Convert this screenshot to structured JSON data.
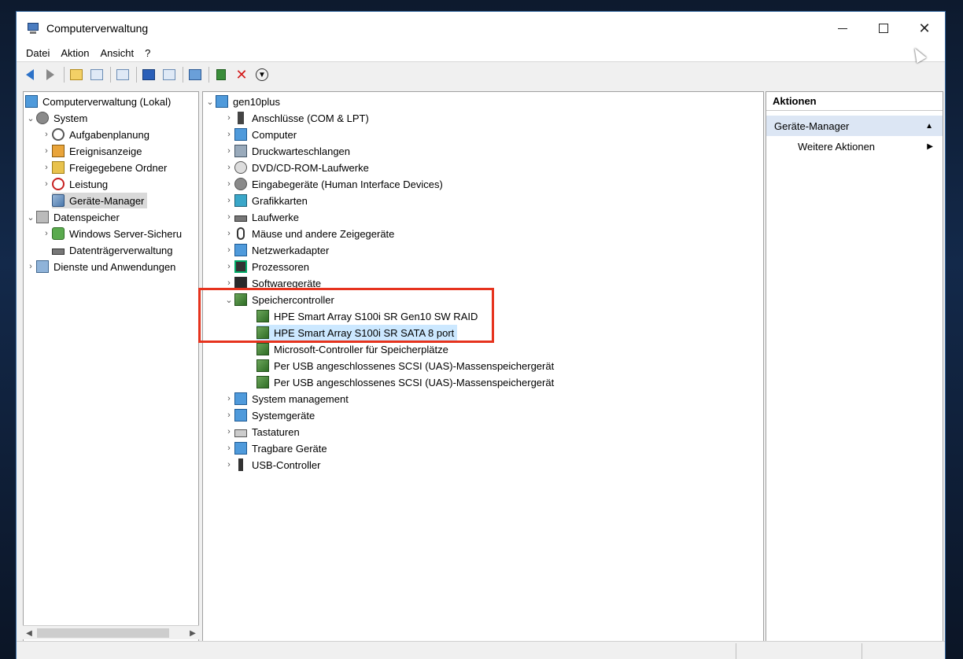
{
  "window": {
    "title": "Computerverwaltung",
    "close_glyph": "✕"
  },
  "menu": [
    "Datei",
    "Aktion",
    "Ansicht",
    "?"
  ],
  "left_tree": {
    "root": "Computerverwaltung (Lokal)",
    "system": "System",
    "system_children": [
      "Aufgabenplanung",
      "Ereignisanzeige",
      "Freigegebene Ordner",
      "Leistung",
      "Geräte-Manager"
    ],
    "storage": "Datenspeicher",
    "storage_children": [
      "Windows Server-Sicheru",
      "Datenträgerverwaltung"
    ],
    "services": "Dienste und Anwendungen"
  },
  "device_tree": {
    "root": "gen10plus",
    "categories_before": [
      "Anschlüsse (COM & LPT)",
      "Computer",
      "Druckwarteschlangen",
      "DVD/CD-ROM-Laufwerke",
      "Eingabegeräte (Human Interface Devices)",
      "Grafikkarten",
      "Laufwerke",
      "Mäuse und andere Zeigegeräte",
      "Netzwerkadapter",
      "Prozessoren",
      "Softwaregeräte"
    ],
    "expanded": "Speichercontroller",
    "expanded_children": [
      "HPE Smart Array S100i SR Gen10 SW RAID",
      "HPE Smart Array S100i SR SATA 8 port",
      "Microsoft-Controller für Speicherplätze",
      "Per USB angeschlossenes SCSI (UAS)-Massenspeichergerät",
      "Per USB angeschlossenes SCSI (UAS)-Massenspeichergerät"
    ],
    "categories_after": [
      "System management",
      "Systemgeräte",
      "Tastaturen",
      "Tragbare Geräte",
      "USB-Controller"
    ]
  },
  "actions": {
    "header": "Aktionen",
    "section": "Geräte-Manager",
    "item": "Weitere Aktionen"
  },
  "colors": {
    "highlight_box": "#e6331e",
    "selected": "#cce8ff"
  }
}
